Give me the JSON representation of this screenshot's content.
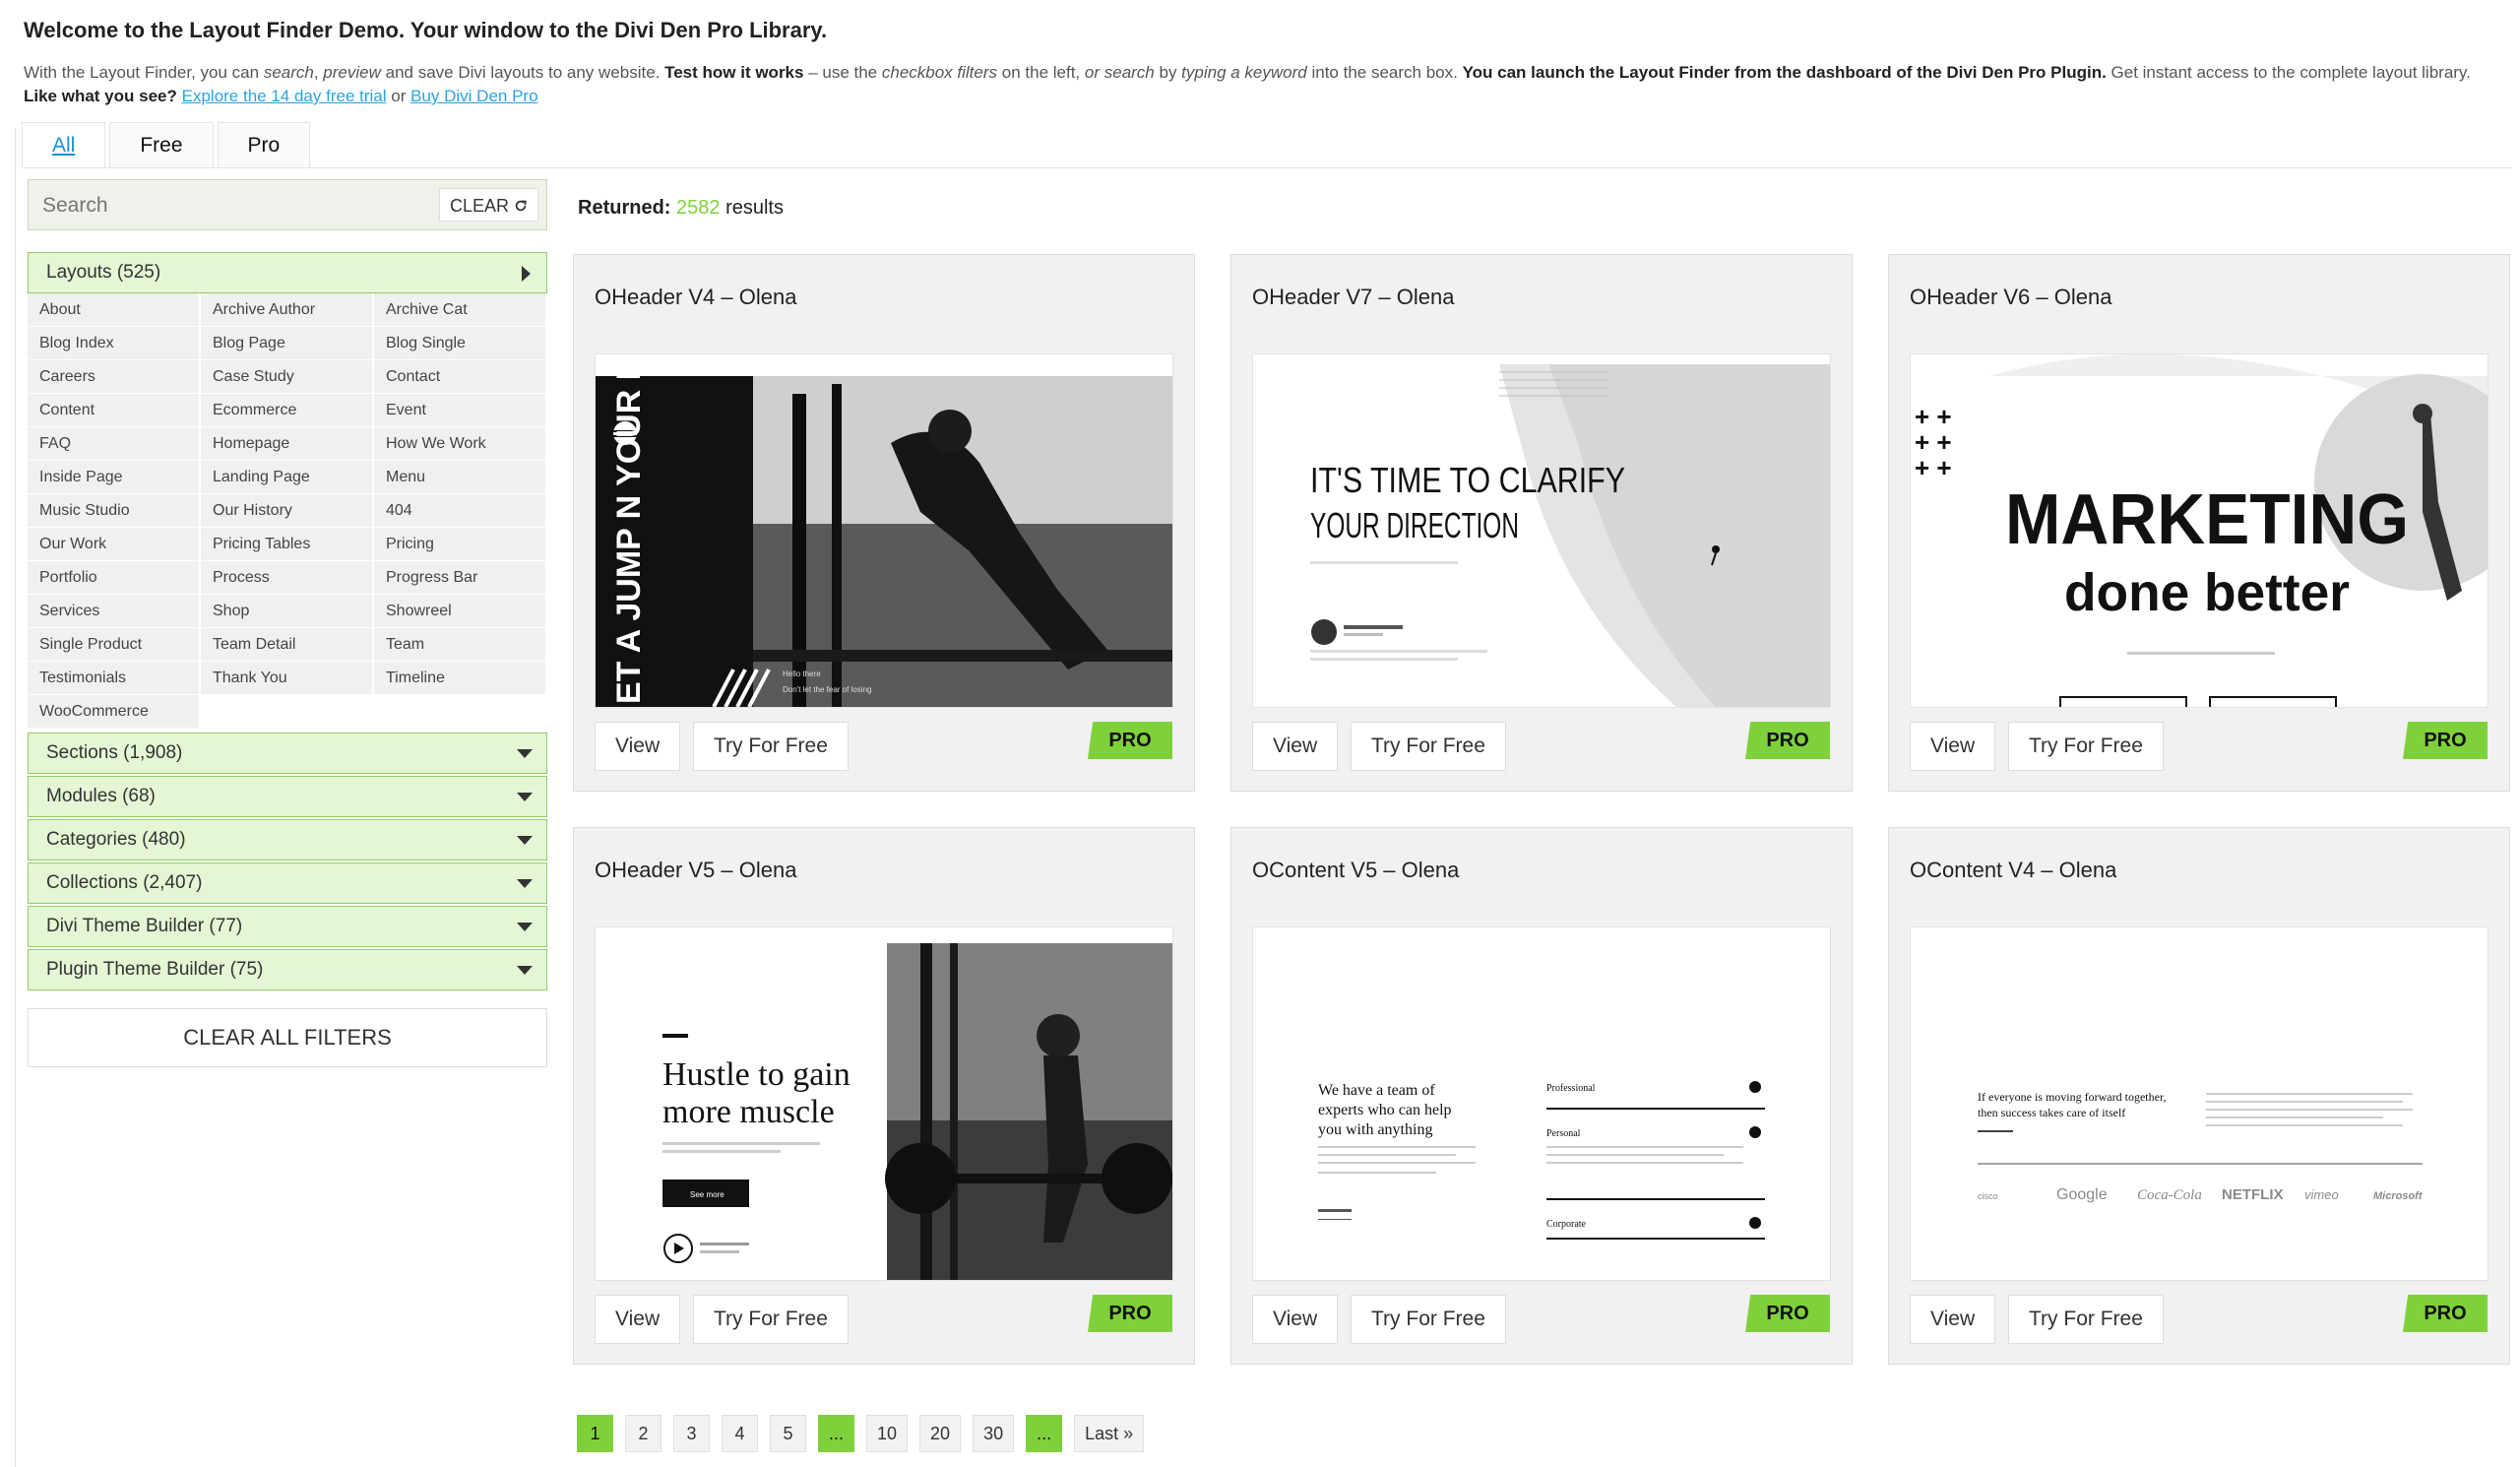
{
  "header": {
    "title": "Welcome to the Layout Finder Demo. Your window to the Divi Den Pro Library.",
    "intro": {
      "p1": "With the Layout Finder, you can ",
      "search": "search",
      "sep1": ", ",
      "preview": "preview",
      "p2": " and save Divi layouts to any website. ",
      "test": "Test how it works",
      "p3": " – use the ",
      "checkbox": "checkbox filters",
      "p4": " on the left, ",
      "or": "or",
      "p5": " ",
      "search2": "search",
      "p6": " by ",
      "typing": "typing a keyword",
      "p7": " into the search box. ",
      "launch": "You can launch the Layout Finder from the dashboard of the Divi Den Pro Plugin.",
      "p8": " Get instant access to the complete layout library.",
      "like": "Like what you see?",
      "p9": " ",
      "link1": "Explore the 14 day free trial",
      "p10": " or ",
      "link2": "Buy Divi Den Pro"
    }
  },
  "tabs": [
    {
      "label": "All",
      "active": true
    },
    {
      "label": "Free"
    },
    {
      "label": "Pro"
    }
  ],
  "search": {
    "placeholder": "Search",
    "clear_label": "CLEAR",
    "clear_icon": "refresh-icon"
  },
  "accordions": {
    "layouts": "Layouts (525)",
    "sections": "Sections (1,908)",
    "modules": "Modules (68)",
    "categories": "Categories (480)",
    "collections": "Collections (2,407)",
    "theme_builder": "Divi Theme Builder (77)",
    "plugin_builder": "Plugin Theme Builder (75)"
  },
  "filters": [
    "About",
    "Archive Author",
    "Archive Cat",
    "Blog Index",
    "Blog Page",
    "Blog Single",
    "Careers",
    "Case Study",
    "Contact",
    "Content",
    "Ecommerce",
    "Event",
    "FAQ",
    "Homepage",
    "How We Work",
    "Inside Page",
    "Landing Page",
    "Menu",
    "Music Studio",
    "Our History",
    "404",
    "Our Work",
    "Pricing Tables",
    "Pricing",
    "Portfolio",
    "Process",
    "Progress Bar",
    "Services",
    "Shop",
    "Showreel",
    "Single Product",
    "Team Detail",
    "Team",
    "Testimonials",
    "Thank You",
    "Timeline",
    "WooCommerce"
  ],
  "clear_all": "CLEAR ALL FILTERS",
  "results": {
    "label": "Returned:",
    "count": "2582",
    "suffix": "results"
  },
  "cards": [
    {
      "title": "OHeader V4 – Olena",
      "view": "View",
      "try": "Try For Free",
      "badge": "PRO",
      "thumb": {
        "vertical_text": "ET A JUMP N YOUR DAY",
        "small1": "Hello there",
        "small2": "Don't let the fear of losing"
      }
    },
    {
      "title": "OHeader V7 – Olena",
      "view": "View",
      "try": "Try For Free",
      "badge": "PRO",
      "thumb": {
        "line1": "IT'S TIME TO CLARIFY",
        "line2": "YOUR DIRECTION"
      }
    },
    {
      "title": "OHeader V6 – Olena",
      "view": "View",
      "try": "Try For Free",
      "badge": "PRO",
      "thumb": {
        "line1": "MARKETING",
        "line2": "done better"
      }
    },
    {
      "title": "OHeader V5 – Olena",
      "view": "View",
      "try": "Try For Free",
      "badge": "PRO",
      "thumb": {
        "line1": "Hustle to gain",
        "line2": "more muscle",
        "btn": "See more"
      }
    },
    {
      "title": "OContent V5 – Olena",
      "view": "View",
      "try": "Try For Free",
      "badge": "PRO",
      "thumb": {
        "line1": "We have a team of",
        "line2": "experts who can help",
        "line3": "you with anything",
        "opt1": "Professional",
        "opt2": "Personal",
        "opt3": "Corporate"
      }
    },
    {
      "title": "OContent V4 – Olena",
      "view": "View",
      "try": "Try For Free",
      "badge": "PRO",
      "thumb": {
        "line1": "If everyone is moving forward together,",
        "line2": "then success takes care of itself",
        "logos": [
          "cisco",
          "Google",
          "Coca-Cola",
          "NETFLIX",
          "vimeo",
          "Microsoft"
        ]
      }
    }
  ],
  "pagination": [
    "1",
    "2",
    "3",
    "4",
    "5",
    "...",
    "10",
    "20",
    "30",
    "...",
    "Last »"
  ],
  "colors": {
    "accent": "#7fd13b",
    "link": "#29a3e0",
    "filter_bg": "#e4f6d4"
  }
}
